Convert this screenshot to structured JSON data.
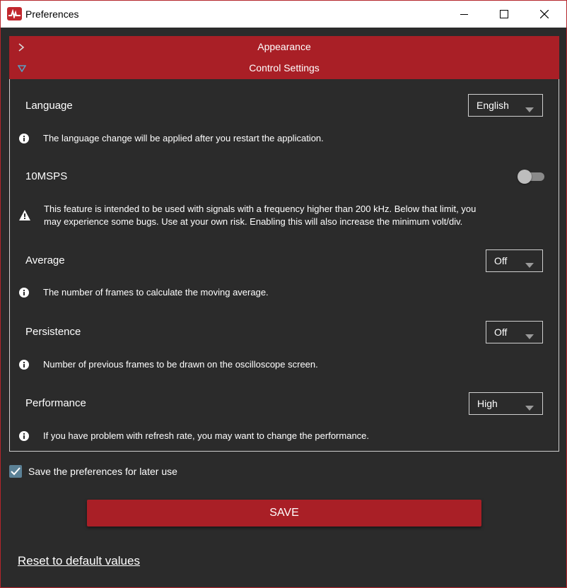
{
  "window": {
    "title": "Preferences",
    "icons": {
      "app": "oscilloscope-logo-icon",
      "minimize": "minimize-icon",
      "maximize": "maximize-icon",
      "close": "close-icon"
    }
  },
  "accordion": {
    "appearance_label": "Appearance",
    "control_label": "Control Settings"
  },
  "settings": {
    "language": {
      "label": "Language",
      "value": "English",
      "info": "The language change will be applied after you restart the application."
    },
    "msps": {
      "label": "10MSPS",
      "enabled": false,
      "warning_line1": "This feature is intended to be used with signals with a frequency higher than 200 kHz. Below that limit, you",
      "warning_line2": "may experience some bugs. Use at your own risk. Enabling this will also increase the minimum volt/div."
    },
    "average": {
      "label": "Average",
      "value": "Off",
      "info": "The number of frames to calculate the moving average."
    },
    "persistence": {
      "label": "Persistence",
      "value": "Off",
      "info": "Number of previous frames to be drawn on the oscilloscope screen."
    },
    "performance": {
      "label": "Performance",
      "value": "High",
      "info": "If you have problem with refresh rate, you may want to change the performance."
    }
  },
  "save_preferences": {
    "label": "Save the preferences for later use",
    "checked": true
  },
  "save_button_label": "SAVE",
  "reset_link_label": "Reset to default values",
  "colors": {
    "accent": "#a91f26",
    "background": "#2b2b2b",
    "checkbox": "#5b8196"
  }
}
